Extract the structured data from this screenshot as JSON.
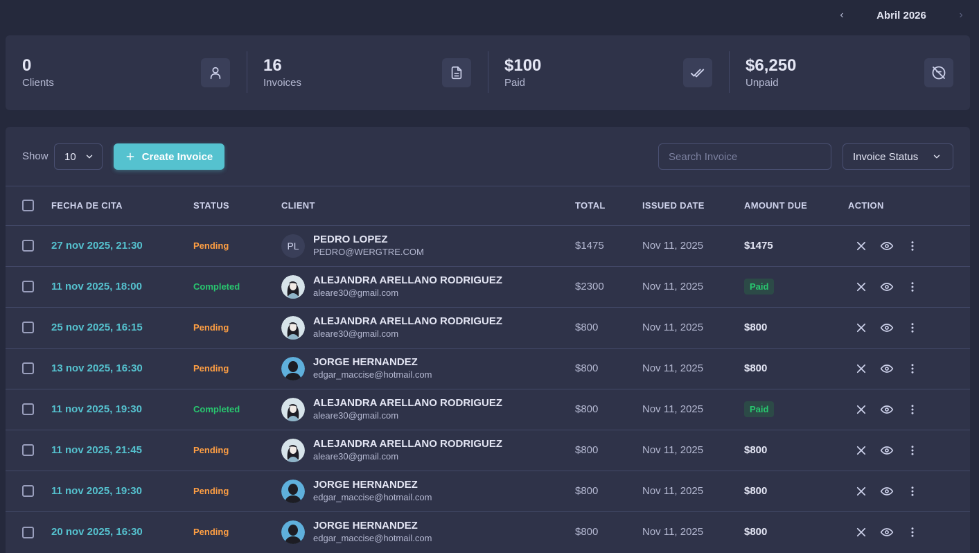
{
  "month_nav": {
    "label": "Abril 2026",
    "prev": "‹",
    "next": "›"
  },
  "stats": [
    {
      "value": "0",
      "label": "Clients",
      "icon": "user-icon"
    },
    {
      "value": "16",
      "label": "Invoices",
      "icon": "document-icon"
    },
    {
      "value": "$100",
      "label": "Paid",
      "icon": "double-check-icon"
    },
    {
      "value": "$6,250",
      "label": "Unpaid",
      "icon": "circle-slash-icon"
    }
  ],
  "toolbar": {
    "show_label": "Show",
    "show_value": "10",
    "create_label": "Create Invoice",
    "search_placeholder": "Search Invoice",
    "status_filter": "Invoice Status"
  },
  "table": {
    "headers": [
      "FECHA DE CITA",
      "STATUS",
      "CLIENT",
      "TOTAL",
      "ISSUED DATE",
      "AMOUNT DUE",
      "ACTION"
    ],
    "rows": [
      {
        "date": "27 nov 2025, 21:30",
        "status": "Pending",
        "client": "PEDRO LOPEZ",
        "email": "PEDRO@WERGTRE.COM",
        "avatar": "initials",
        "initials": "PL",
        "total": "$1475",
        "issued": "Nov 11, 2025",
        "due": "$1475"
      },
      {
        "date": "11 nov 2025, 18:00",
        "status": "Completed",
        "client": "ALEJANDRA ARELLANO RODRIGUEZ",
        "email": "aleare30@gmail.com",
        "avatar": "female",
        "initials": "",
        "total": "$2300",
        "issued": "Nov 11, 2025",
        "due": "Paid"
      },
      {
        "date": "25 nov 2025, 16:15",
        "status": "Pending",
        "client": "ALEJANDRA ARELLANO RODRIGUEZ",
        "email": "aleare30@gmail.com",
        "avatar": "female",
        "initials": "",
        "total": "$800",
        "issued": "Nov 11, 2025",
        "due": "$800"
      },
      {
        "date": "13 nov 2025, 16:30",
        "status": "Pending",
        "client": "JORGE HERNANDEZ",
        "email": "edgar_maccise@hotmail.com",
        "avatar": "male",
        "initials": "",
        "total": "$800",
        "issued": "Nov 11, 2025",
        "due": "$800"
      },
      {
        "date": "11 nov 2025, 19:30",
        "status": "Completed",
        "client": "ALEJANDRA ARELLANO RODRIGUEZ",
        "email": "aleare30@gmail.com",
        "avatar": "female",
        "initials": "",
        "total": "$800",
        "issued": "Nov 11, 2025",
        "due": "Paid"
      },
      {
        "date": "11 nov 2025, 21:45",
        "status": "Pending",
        "client": "ALEJANDRA ARELLANO RODRIGUEZ",
        "email": "aleare30@gmail.com",
        "avatar": "female",
        "initials": "",
        "total": "$800",
        "issued": "Nov 11, 2025",
        "due": "$800"
      },
      {
        "date": "11 nov 2025, 19:30",
        "status": "Pending",
        "client": "JORGE HERNANDEZ",
        "email": "edgar_maccise@hotmail.com",
        "avatar": "male",
        "initials": "",
        "total": "$800",
        "issued": "Nov 11, 2025",
        "due": "$800"
      },
      {
        "date": "20 nov 2025, 16:30",
        "status": "Pending",
        "client": "JORGE HERNANDEZ",
        "email": "edgar_maccise@hotmail.com",
        "avatar": "male",
        "initials": "",
        "total": "$800",
        "issued": "Nov 11, 2025",
        "due": "$800"
      }
    ]
  },
  "colors": {
    "accent": "#55c2cf",
    "pending": "#ff9f43",
    "completed": "#28c76f",
    "background": "#25293c",
    "card": "#2f3349"
  }
}
